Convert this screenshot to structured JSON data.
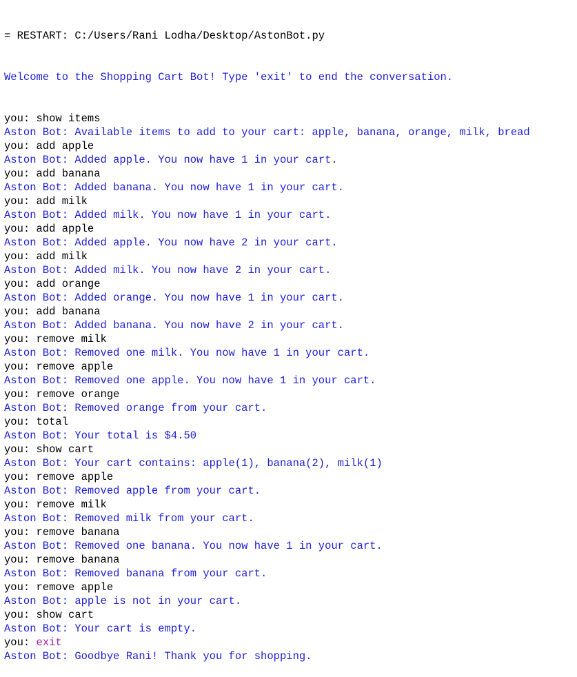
{
  "colors": {
    "background": "#ffffff",
    "output_text": "#1e1ed6",
    "input_text": "#000000",
    "exit_keyword": "#a020a0"
  },
  "shell": {
    "restart_line": "= RESTART: C:/Users/Rani Lodha/Desktop/AstonBot.py",
    "welcome": "Welcome to the Shopping Cart Bot! Type 'exit' to end the conversation.",
    "lines": [
      {
        "type": "user",
        "text": "you: show items"
      },
      {
        "type": "bot",
        "text": "Aston Bot: Available items to add to your cart: apple, banana, orange, milk, bread"
      },
      {
        "type": "user",
        "text": "you: add apple"
      },
      {
        "type": "bot",
        "text": "Aston Bot: Added apple. You now have 1 in your cart."
      },
      {
        "type": "user",
        "text": "you: add banana"
      },
      {
        "type": "bot",
        "text": "Aston Bot: Added banana. You now have 1 in your cart."
      },
      {
        "type": "user",
        "text": "you: add milk"
      },
      {
        "type": "bot",
        "text": "Aston Bot: Added milk. You now have 1 in your cart."
      },
      {
        "type": "user",
        "text": "you: add apple"
      },
      {
        "type": "bot",
        "text": "Aston Bot: Added apple. You now have 2 in your cart."
      },
      {
        "type": "user",
        "text": "you: add milk"
      },
      {
        "type": "bot",
        "text": "Aston Bot: Added milk. You now have 2 in your cart."
      },
      {
        "type": "user",
        "text": "you: add orange"
      },
      {
        "type": "bot",
        "text": "Aston Bot: Added orange. You now have 1 in your cart."
      },
      {
        "type": "user",
        "text": "you: add banana"
      },
      {
        "type": "bot",
        "text": "Aston Bot: Added banana. You now have 2 in your cart."
      },
      {
        "type": "user",
        "text": "you: remove milk"
      },
      {
        "type": "bot",
        "text": "Aston Bot: Removed one milk. You now have 1 in your cart."
      },
      {
        "type": "user",
        "text": "you: remove apple"
      },
      {
        "type": "bot",
        "text": "Aston Bot: Removed one apple. You now have 1 in your cart."
      },
      {
        "type": "user",
        "text": "you: remove orange"
      },
      {
        "type": "bot",
        "text": "Aston Bot: Removed orange from your cart."
      },
      {
        "type": "user",
        "text": "you: total"
      },
      {
        "type": "bot",
        "text": "Aston Bot: Your total is $4.50"
      },
      {
        "type": "user",
        "text": "you: show cart"
      },
      {
        "type": "bot",
        "text": "Aston Bot: Your cart contains: apple(1), banana(2), milk(1)"
      },
      {
        "type": "user",
        "text": "you: remove apple"
      },
      {
        "type": "bot",
        "text": "Aston Bot: Removed apple from your cart."
      },
      {
        "type": "user",
        "text": "you: remove milk"
      },
      {
        "type": "bot",
        "text": "Aston Bot: Removed milk from your cart."
      },
      {
        "type": "user",
        "text": "you: remove banana"
      },
      {
        "type": "bot",
        "text": "Aston Bot: Removed one banana. You now have 1 in your cart."
      },
      {
        "type": "user",
        "text": "you: remove banana"
      },
      {
        "type": "bot",
        "text": "Aston Bot: Removed banana from your cart."
      },
      {
        "type": "user",
        "text": "you: remove apple"
      },
      {
        "type": "bot",
        "text": "Aston Bot: apple is not in your cart."
      },
      {
        "type": "user",
        "text": "you: show cart"
      },
      {
        "type": "bot",
        "text": "Aston Bot: Your cart is empty."
      },
      {
        "type": "user-exit",
        "prompt": "you: ",
        "input": "exit"
      },
      {
        "type": "bot",
        "text": "Aston Bot: Goodbye Rani! Thank you for shopping."
      }
    ]
  }
}
